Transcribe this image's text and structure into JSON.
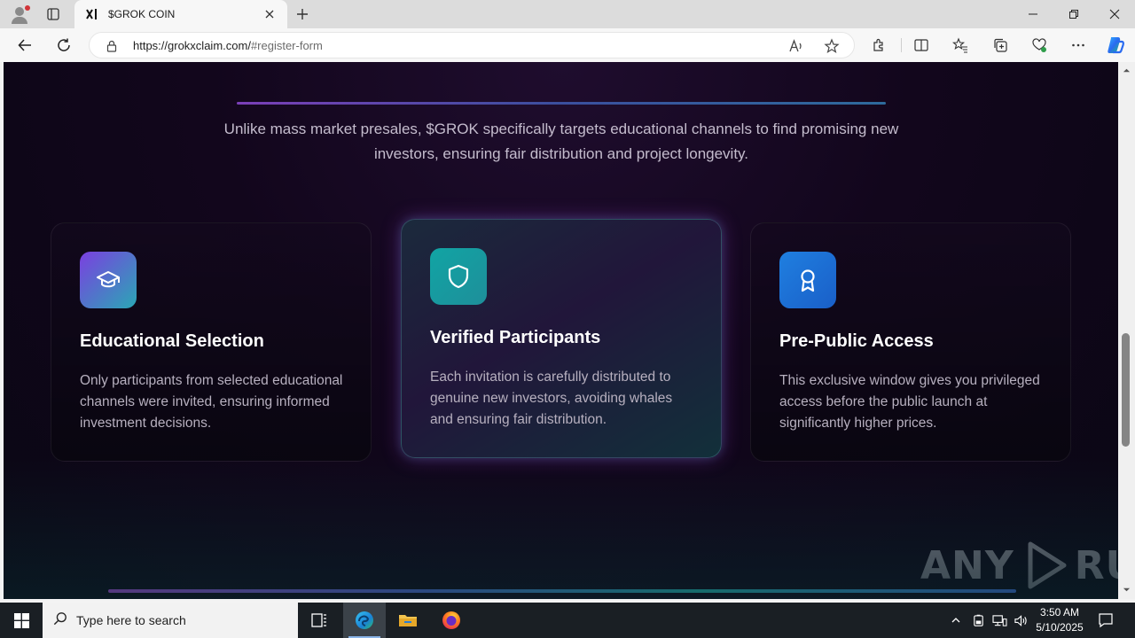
{
  "browser": {
    "tab": {
      "title": "$GROK COIN"
    },
    "address": {
      "url_host": "https://grokxclaim.com/",
      "url_rest": "#register-form"
    }
  },
  "page": {
    "lead_text": "Unlike mass market presales, $GROK specifically targets educational channels to find promising new investors, ensuring fair distribution and project longevity.",
    "cards": [
      {
        "icon": "graduation-cap-icon",
        "title": "Educational Selection",
        "text": "Only participants from selected educational channels were invited, ensuring informed investment decisions.",
        "gradient": [
          "#7b3fe0",
          "#2aa7b5"
        ]
      },
      {
        "icon": "shield-icon",
        "title": "Verified Participants",
        "text": "Each invitation is carefully distributed to genuine new investors, avoiding whales and ensuring fair distribution.",
        "gradient": [
          "#11a4a4",
          "#1e8f9a"
        ]
      },
      {
        "icon": "award-ribbon-icon",
        "title": "Pre-Public Access",
        "text": "This exclusive window gives you privileged access before the public launch at significantly higher prices.",
        "gradient": [
          "#1f7fe0",
          "#1a5fc8"
        ]
      }
    ],
    "watermark": "ANY RUN"
  },
  "taskbar": {
    "search_placeholder": "Type here to search",
    "time": "3:50 AM",
    "date": "5/10/2025"
  }
}
